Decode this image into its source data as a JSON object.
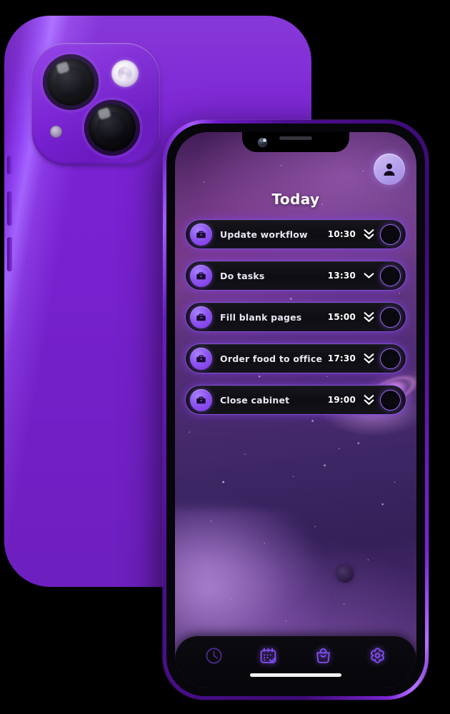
{
  "app": {
    "title": "Today",
    "accent_color": "#8c52f0",
    "body_color": "#7a22d4",
    "row_bg_color": "#0e0d12"
  },
  "header": {
    "title": "Today",
    "avatar_icon": "user-avatar-icon"
  },
  "tasks": [
    {
      "icon": "briefcase-icon",
      "title": "Update workflow",
      "time": "10:30",
      "priority": "double-chevron-down",
      "completed": false
    },
    {
      "icon": "briefcase-icon",
      "title": "Do tasks",
      "time": "13:30",
      "priority": "single-chevron-down",
      "completed": false
    },
    {
      "icon": "briefcase-icon",
      "title": "Fill blank pages",
      "time": "15:00",
      "priority": "double-chevron-down",
      "completed": false
    },
    {
      "icon": "briefcase-icon",
      "title": "Order food to office",
      "time": "17:30",
      "priority": "double-chevron-down",
      "completed": false
    },
    {
      "icon": "briefcase-icon",
      "title": "Close cabinet",
      "time": "19:00",
      "priority": "double-chevron-down",
      "completed": false
    }
  ],
  "tab_bar": {
    "items": [
      {
        "icon": "clock-icon",
        "active": false
      },
      {
        "icon": "calendar-check-icon",
        "active": true
      },
      {
        "icon": "shopping-bag-icon",
        "active": true
      },
      {
        "icon": "flower-settings-icon",
        "active": true
      }
    ]
  },
  "back_phone": {
    "cameras": [
      "lens-top",
      "lens-bottom"
    ],
    "flash": "flash-icon",
    "microphone": "microphone-dot"
  }
}
